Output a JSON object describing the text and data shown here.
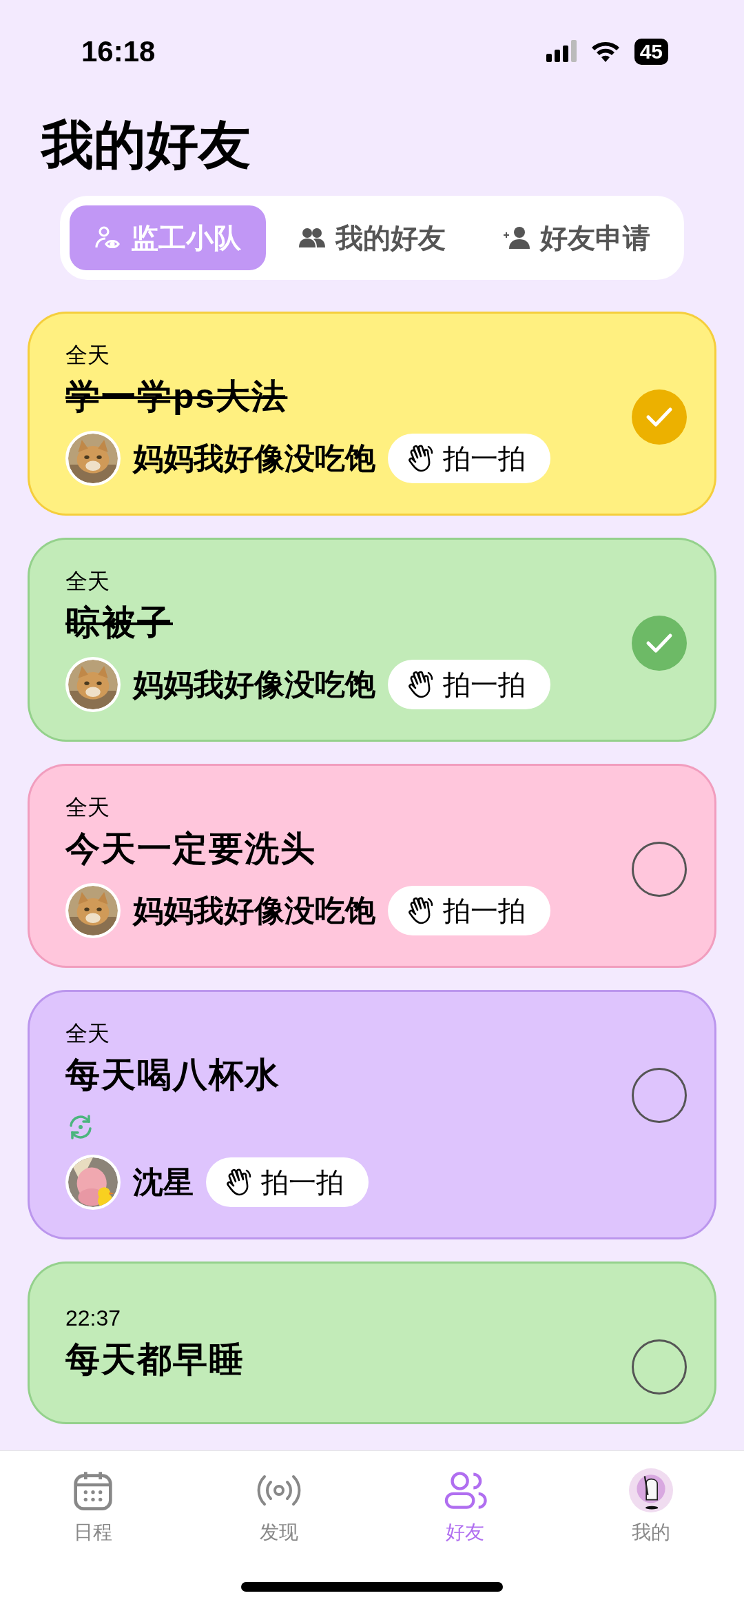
{
  "status_bar": {
    "time": "16:18",
    "battery": "45"
  },
  "title": "我的好友",
  "tabs": [
    {
      "label": "监工小队",
      "selected": true
    },
    {
      "label": "我的好友",
      "selected": false
    },
    {
      "label": "好友申请",
      "selected": false
    }
  ],
  "tasks": [
    {
      "time": "全天",
      "title": "学一学ps大法",
      "done": true,
      "repeat": false,
      "color": "#fff080",
      "friend": {
        "name": "妈妈我好像没吃饱"
      },
      "poke": "拍一拍"
    },
    {
      "time": "全天",
      "title": "晾被子",
      "done": true,
      "repeat": false,
      "color": "#c2ebb8",
      "friend": {
        "name": "妈妈我好像没吃饱"
      },
      "poke": "拍一拍"
    },
    {
      "time": "全天",
      "title": "今天一定要洗头",
      "done": false,
      "repeat": false,
      "color": "#ffc6dc",
      "friend": {
        "name": "妈妈我好像没吃饱"
      },
      "poke": "拍一拍"
    },
    {
      "time": "全天",
      "title": "每天喝八杯水",
      "done": false,
      "repeat": true,
      "color": "#dec4fd",
      "friend": {
        "name": "沈星"
      },
      "poke": "拍一拍"
    },
    {
      "time": "22:37",
      "title": "每天都早睡",
      "done": false,
      "repeat": false,
      "color": "#c2ebb8"
    }
  ],
  "tab_bar": [
    {
      "label": "日程",
      "selected": false
    },
    {
      "label": "发现",
      "selected": false
    },
    {
      "label": "好友",
      "selected": true
    },
    {
      "label": "我的",
      "selected": false
    }
  ]
}
